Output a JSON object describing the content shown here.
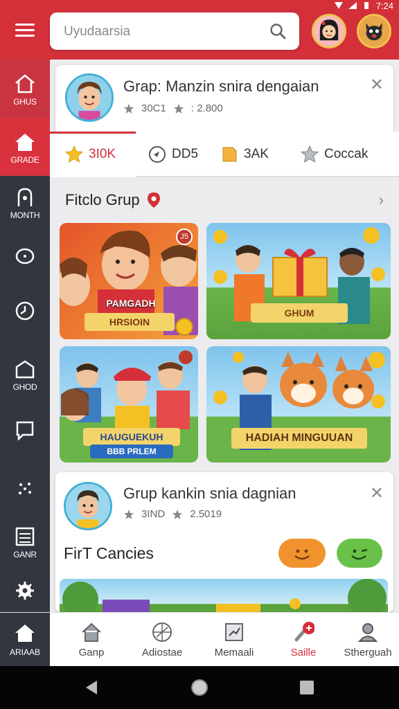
{
  "status": {
    "time": "7:24"
  },
  "search": {
    "placeholder": "Uyudaarsia"
  },
  "sidebar": {
    "items": [
      {
        "label": "GHUS"
      },
      {
        "label": "GRADE"
      },
      {
        "label": "MONTH"
      },
      {
        "label": ""
      },
      {
        "label": ""
      },
      {
        "label": "GHOD"
      },
      {
        "label": ""
      },
      {
        "label": ""
      },
      {
        "label": "GANR"
      },
      {
        "label": ""
      }
    ]
  },
  "card1": {
    "title": "Grap: Manzin snira dengaian",
    "stat1": "30C1",
    "stat2": ": 2.800"
  },
  "tabs": [
    {
      "label": "3I0K"
    },
    {
      "label": "DD5"
    },
    {
      "label": "3AK"
    },
    {
      "label": "Coccak"
    }
  ],
  "section": {
    "title": "Fitclo Grup"
  },
  "tiles": [
    {
      "line1": "PAMGADH",
      "line2": "HRSIOIN",
      "badge": "J5"
    },
    {
      "line1": "GHUM"
    },
    {
      "line1": "HAUGUEKUH",
      "line2": "BBB PRLEM"
    },
    {
      "line1": "HADIAH MINGUUAN"
    }
  ],
  "card2": {
    "title": "Grup kankin snia dagnian",
    "stat1": "3IND",
    "stat2": "2.5019",
    "subtitle": "FirT Cancies"
  },
  "bottomnav": {
    "home": "ARIAAB",
    "items": [
      {
        "label": "Ganp"
      },
      {
        "label": "Adiostae"
      },
      {
        "label": "Memaali"
      },
      {
        "label": "Saille"
      },
      {
        "label": "Stherguah"
      }
    ]
  },
  "colors": {
    "brand": "#d3303a",
    "sidebar": "#32363f",
    "background": "#ececef"
  }
}
